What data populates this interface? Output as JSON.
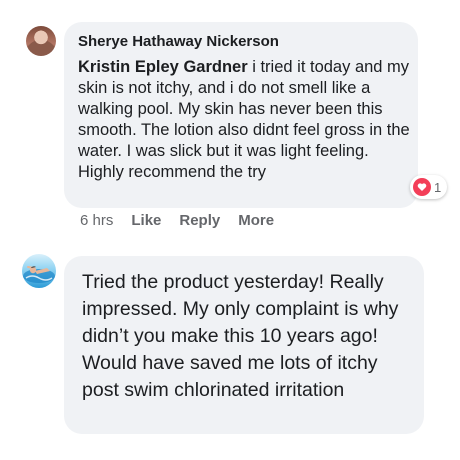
{
  "comments": [
    {
      "author": "Sherye Hathaway Nickerson",
      "mention": "Kristin Epley Gardner",
      "text": " i tried it today and my skin is not itchy, and i do not smell like a walking pool. My skin has never been this smooth. The lotion also didnt feel gross in the water. I was slick but it was light feeling. Highly recommend the try",
      "reaction": {
        "icon": "heart-icon",
        "count": "1",
        "color": "#f33e58"
      },
      "actions": {
        "time": "6 hrs",
        "like": "Like",
        "reply": "Reply",
        "more": "More"
      }
    },
    {
      "text": "Tried the product yesterday! Really impressed. My only complaint is why didn’t you make this 10 years ago! Would have saved me lots of itchy post swim chlorinated irritation"
    }
  ]
}
